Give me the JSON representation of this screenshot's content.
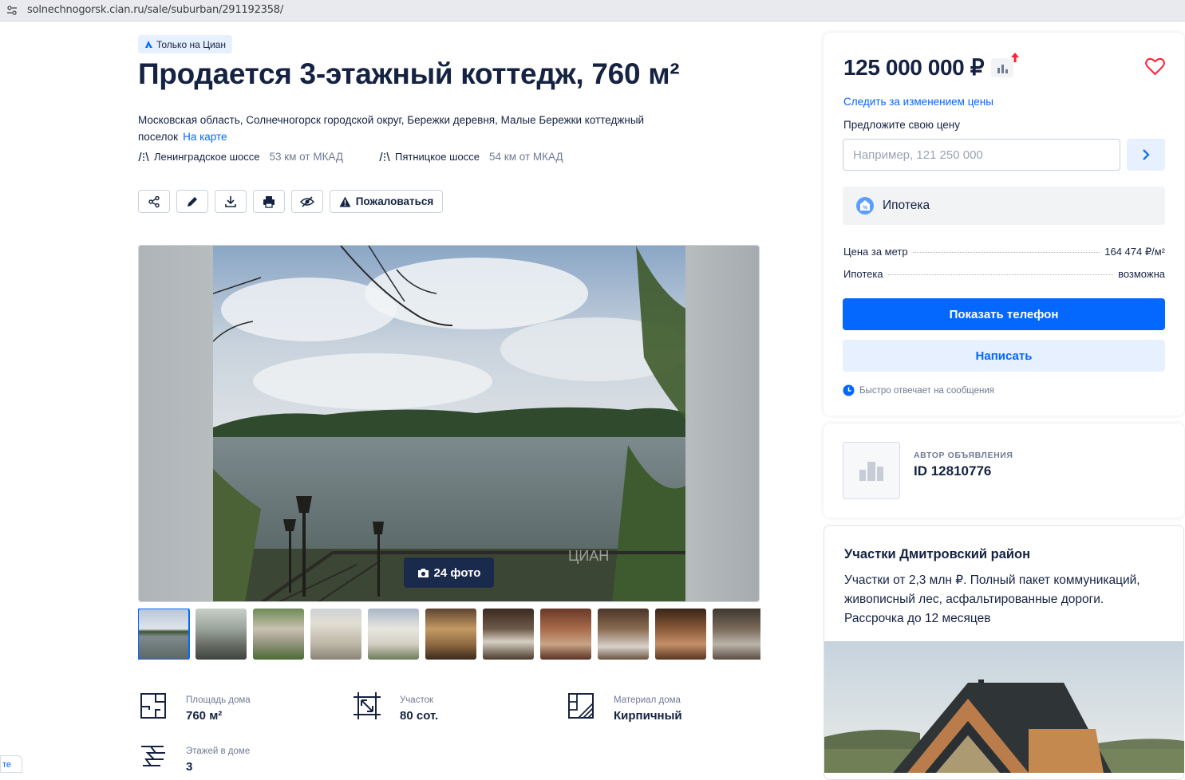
{
  "browser": {
    "url": "solnechnogorsk.cian.ru/sale/suburban/291192358/"
  },
  "badge": {
    "label": "Только на Циан"
  },
  "listing": {
    "title": "Продается 3-этажный коттедж, 760 м²",
    "address": "Московская область, Солнечногорск городской округ, Бережки деревня, Малые Бережки коттеджный поселок",
    "map_link": "На карте",
    "highways": [
      {
        "name": "Ленинградское шоссе",
        "distance": "53 км от МКАД"
      },
      {
        "name": "Пятницкое шоссе",
        "distance": "54 км от МКАД"
      }
    ]
  },
  "toolbar": {
    "icons": [
      "share-icon",
      "edit-icon",
      "download-icon",
      "print-icon",
      "hide-icon"
    ],
    "complain_label": "Пожаловаться"
  },
  "gallery": {
    "photos_label": "24 фото",
    "thumb_count": 11,
    "selected_index": 0
  },
  "features": [
    {
      "label": "Площадь дома",
      "value": "760 м²",
      "icon": "floorplan-icon"
    },
    {
      "label": "Участок",
      "value": "80 сот.",
      "icon": "plot-icon"
    },
    {
      "label": "Материал дома",
      "value": "Кирпичный",
      "icon": "brick-icon"
    },
    {
      "label": "Этажей в доме",
      "value": "3",
      "icon": "stairs-icon"
    }
  ],
  "price_card": {
    "price": "125 000 000 ₽",
    "watch_link": "Следить за изменением цены",
    "offer_label": "Предложите свою цену",
    "offer_placeholder": "Например, 121 250 000",
    "mortgage_label": "Ипотека",
    "details": [
      {
        "key": "Цена за метр",
        "value": "164 474 ₽/м²"
      },
      {
        "key": "Ипотека",
        "value": "возможна"
      }
    ],
    "show_phone": "Показать телефон",
    "write": "Написать",
    "fast_reply": "Быстро отвечает на сообщения"
  },
  "author": {
    "caption": "АВТОР ОБЪЯВЛЕНИЯ",
    "id": "ID 12810776"
  },
  "ad": {
    "title": "Участки Дмитровский район",
    "text": "Участки от 2,3 млн ₽. Полный пакет коммуникаций, живописный лес, асфальтированные дороги. Рассрочка до 12 месяцев"
  },
  "bottom_tab": {
    "label": "те"
  },
  "colors": {
    "accent": "#0468ff",
    "text": "#152242",
    "muted": "#707a95",
    "price_up": "#ff1f34"
  }
}
